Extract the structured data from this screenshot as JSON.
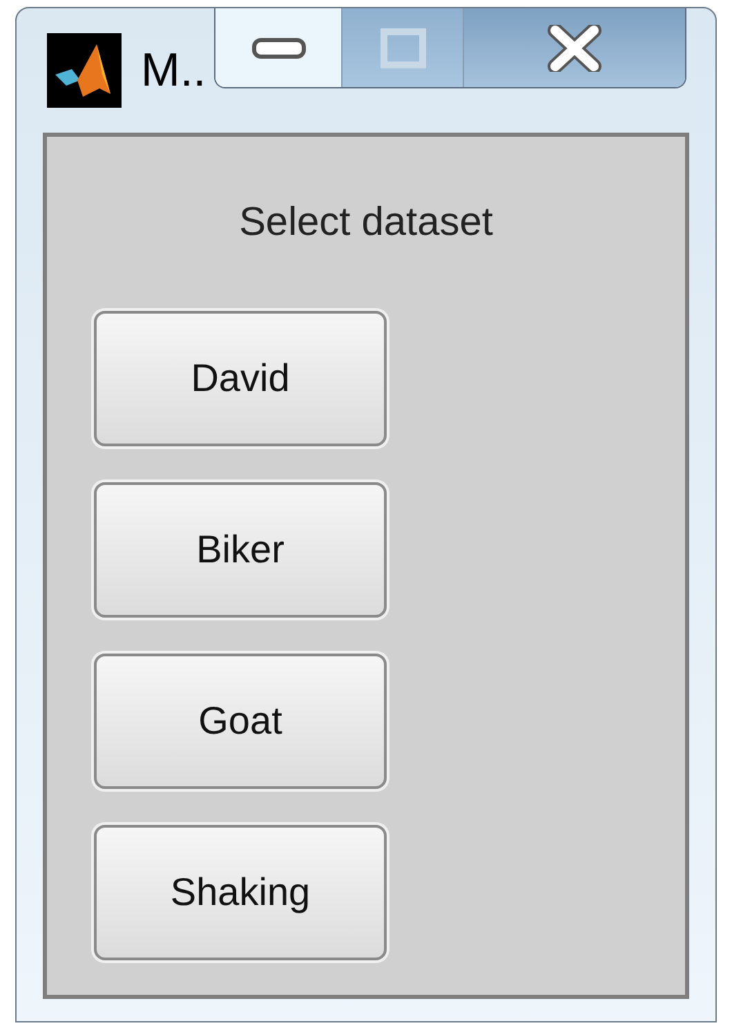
{
  "window": {
    "title": "M.."
  },
  "panel": {
    "heading": "Select dataset"
  },
  "buttons": [
    "David",
    "Biker",
    "Goat",
    "Shaking"
  ]
}
